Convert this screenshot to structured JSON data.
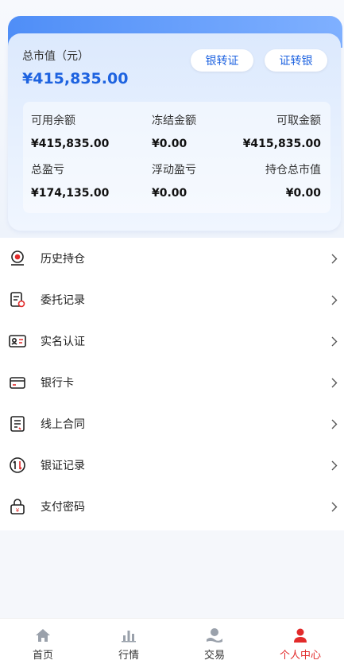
{
  "account": {
    "total_label": "总市值（元）",
    "total_value": "¥415,835.00",
    "bank_to_securities": "银转证",
    "securities_to_bank": "证转银"
  },
  "stats": {
    "available_label": "可用余额",
    "available_value": "¥415,835.00",
    "frozen_label": "冻结金额",
    "frozen_value": "¥0.00",
    "withdrawable_label": "可取金额",
    "withdrawable_value": "¥415,835.00",
    "total_pl_label": "总盈亏",
    "total_pl_value": "¥174,135.00",
    "floating_pl_label": "浮动盈亏",
    "floating_pl_value": "¥0.00",
    "position_value_label": "持仓总市值",
    "position_value_value": "¥0.00"
  },
  "menu": {
    "items": [
      {
        "label": "历史持仓",
        "icon": "history-position-icon"
      },
      {
        "label": "委托记录",
        "icon": "order-record-icon"
      },
      {
        "label": "实名认证",
        "icon": "id-card-icon"
      },
      {
        "label": "银行卡",
        "icon": "bank-card-icon"
      },
      {
        "label": "线上合同",
        "icon": "contract-icon"
      },
      {
        "label": "银证记录",
        "icon": "transfer-record-icon"
      },
      {
        "label": "支付密码",
        "icon": "lock-icon"
      }
    ]
  },
  "tabbar": {
    "home": "首页",
    "market": "行情",
    "trade": "交易",
    "profile": "个人中心",
    "active_color": "#e22a2a"
  }
}
